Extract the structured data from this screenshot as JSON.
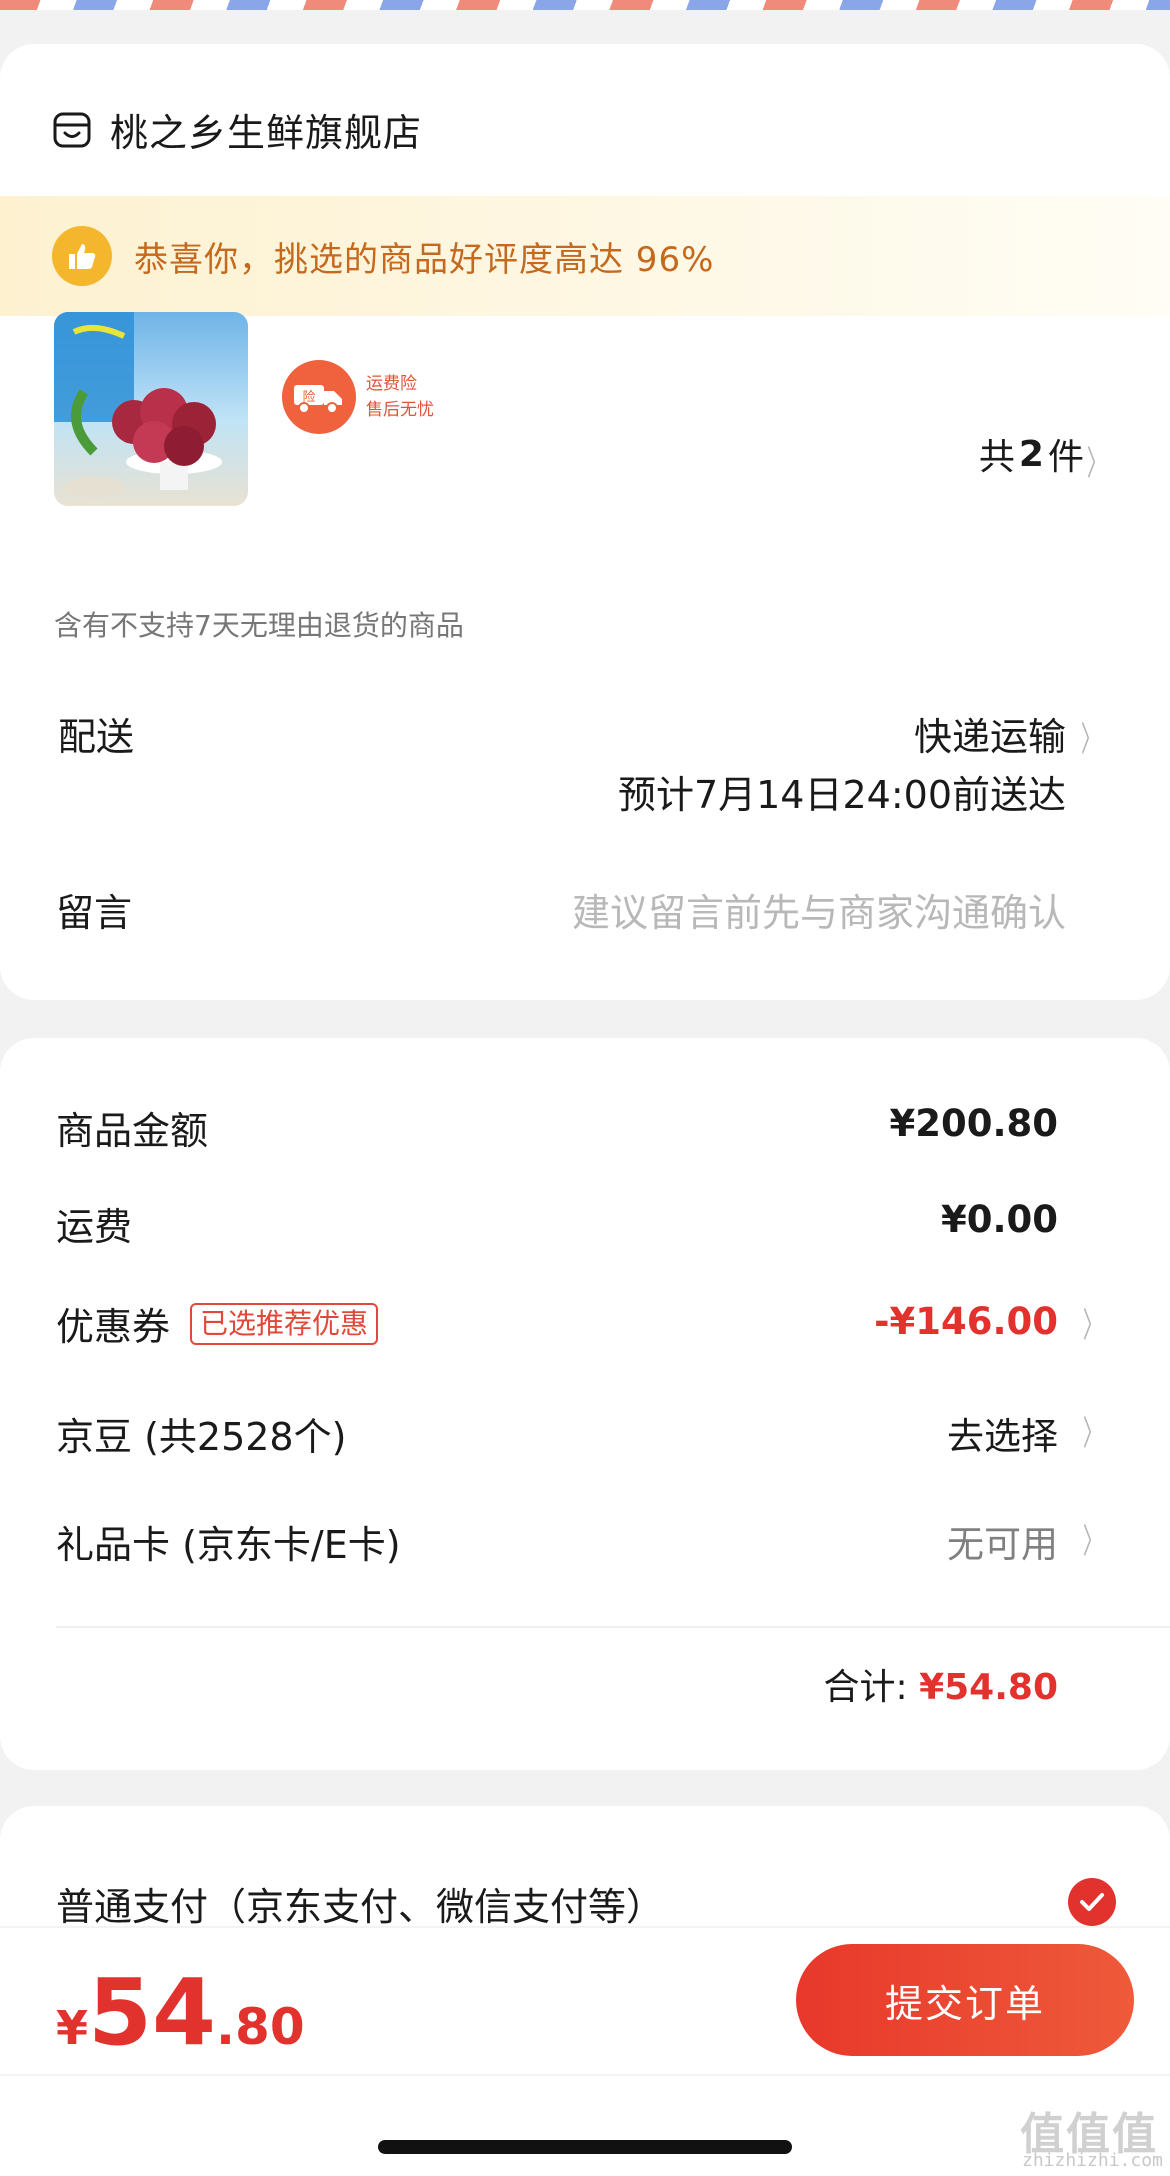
{
  "shop": {
    "name": "桃之乡生鲜旗舰店",
    "icon": "shop-icon"
  },
  "banner": {
    "text": "恭喜你，挑选的商品好评度高达 96%",
    "icon": "thumbs-up-icon"
  },
  "product": {
    "image": "product-photo",
    "badge_line1": "运费险",
    "badge_line2": "售后无忧",
    "badge_icon_text": "险",
    "count_prefix": "共",
    "count": "2",
    "count_suffix": "件"
  },
  "notice": "含有不支持7天无理由退货的商品",
  "delivery": {
    "label": "配送",
    "method": "快递运输",
    "eta": "预计7月14日24:00前送达"
  },
  "message": {
    "label": "留言",
    "placeholder": "建议留言前先与商家沟通确认"
  },
  "price": {
    "goods_label": "商品金额",
    "goods_value": "¥200.80",
    "freight_label": "运费",
    "freight_value": "¥0.00",
    "coupon_label": "优惠券",
    "coupon_tag": "已选推荐优惠",
    "coupon_value": "-¥146.00",
    "beans_label": "京豆 (共2528个)",
    "beans_value": "去选择",
    "giftcard_label": "礼品卡 (京东卡/E卡)",
    "giftcard_value": "无可用",
    "total_label": "合计:",
    "total_value": "¥54.80"
  },
  "payment": {
    "label": "普通支付（京东支付、微信支付等）",
    "selected": true
  },
  "bottom": {
    "currency": "¥",
    "amount_int": "54",
    "amount_dec": ".80",
    "submit_label": "提交订单"
  },
  "watermark": {
    "logo": "值值值",
    "text": "zhizhizhi.com"
  },
  "colors": {
    "accent": "#e2322e",
    "banner_text": "#c4691d",
    "coupon_tag": "#e0483a"
  }
}
